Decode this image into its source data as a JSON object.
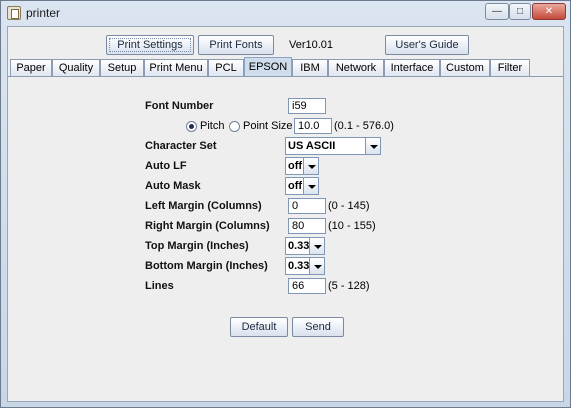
{
  "window": {
    "title": "printer",
    "minimize_symbol": "—",
    "maximize_symbol": "□",
    "close_symbol": "✕"
  },
  "toolbar": {
    "print_settings_label": "Print Settings",
    "print_fonts_label": "Print Fonts",
    "version_label": "Ver10.01",
    "users_guide_label": "User's Guide"
  },
  "tabs": [
    "Paper",
    "Quality",
    "Setup",
    "Print Menu",
    "PCL",
    "EPSON",
    "IBM",
    "Network",
    "Interface",
    "Custom",
    "Filter"
  ],
  "active_tab": "EPSON",
  "form": {
    "font_number": {
      "label": "Font Number",
      "value": "i59"
    },
    "pitch_radio": {
      "label": "Pitch",
      "checked": true
    },
    "point_size_radio": {
      "label": "Point Size",
      "checked": false
    },
    "pitch_value": {
      "value": "10.0",
      "range": "(0.1 - 576.0)"
    },
    "character_set": {
      "label": "Character Set",
      "value": "US ASCII"
    },
    "auto_lf": {
      "label": "Auto LF",
      "value": "off"
    },
    "auto_mask": {
      "label": "Auto Mask",
      "value": "off"
    },
    "left_margin": {
      "label": "Left Margin (Columns)",
      "value": "0",
      "range": "(0  -  145)"
    },
    "right_margin": {
      "label": "Right Margin (Columns)",
      "value": "80",
      "range": "(10  -  155)"
    },
    "top_margin": {
      "label": "Top Margin (Inches)",
      "value": "0.33"
    },
    "bottom_margin": {
      "label": "Bottom Margin (Inches)",
      "value": "0.33"
    },
    "lines": {
      "label": "Lines",
      "value": "66",
      "range": "(5  -  128)"
    }
  },
  "actions": {
    "default_label": "Default",
    "send_label": "Send"
  }
}
